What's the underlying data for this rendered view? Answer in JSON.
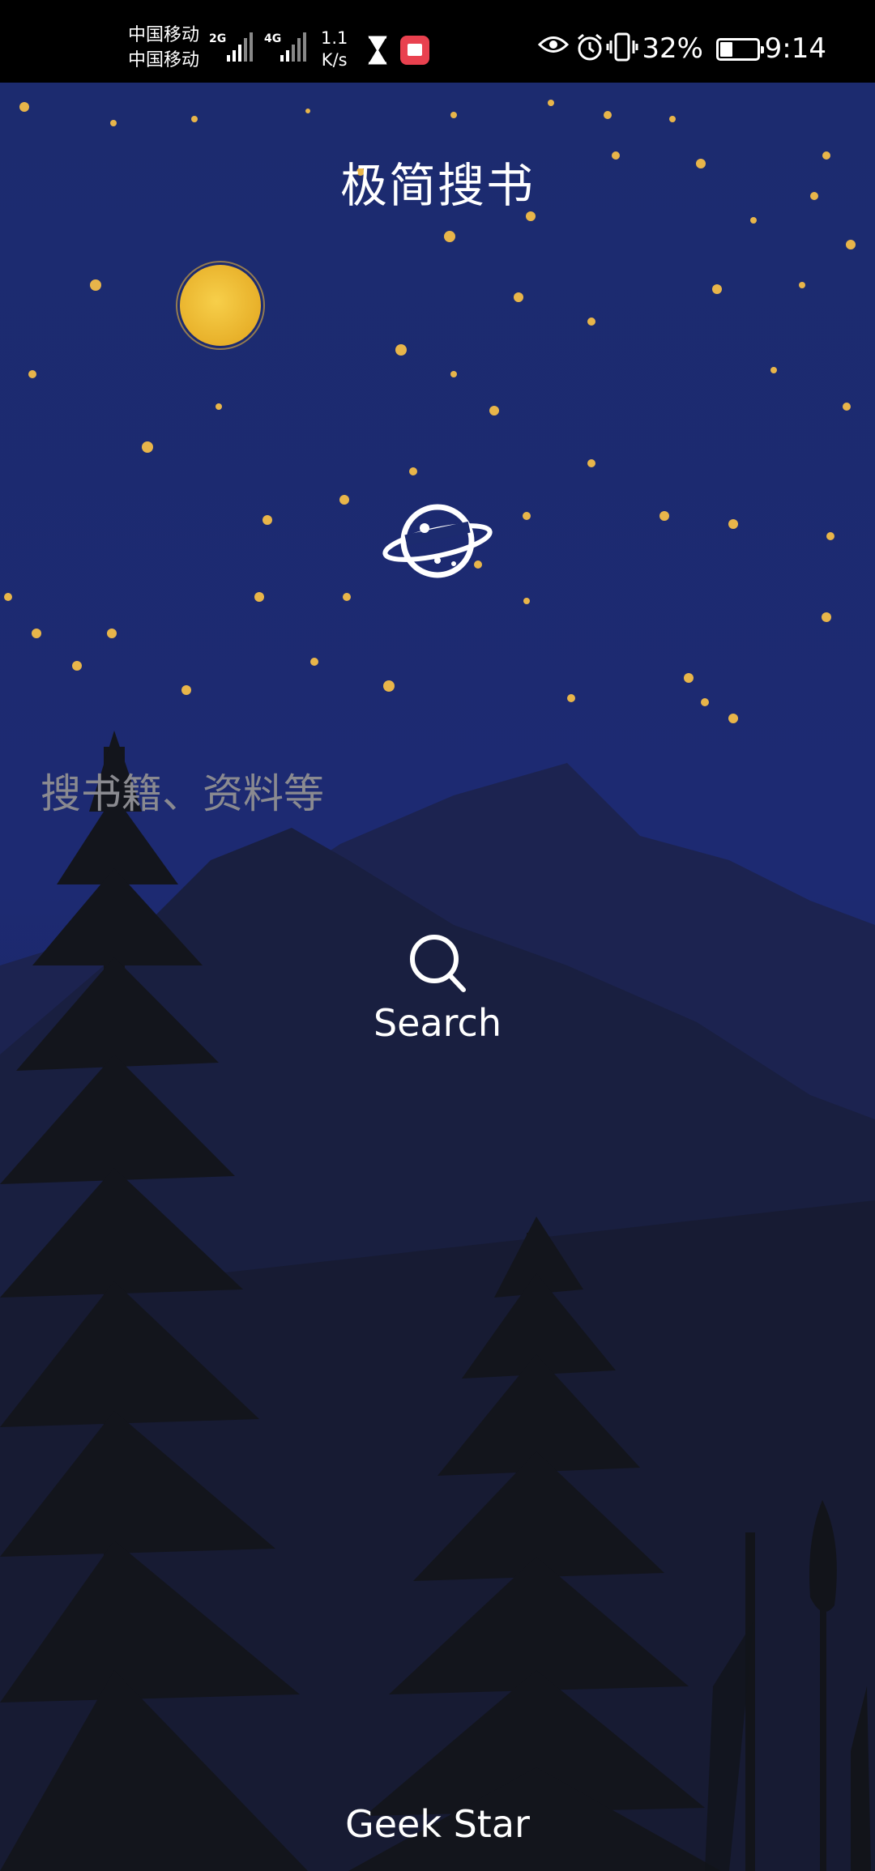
{
  "status_bar": {
    "carrier_1": "中国移动",
    "carrier_2": "中国移动",
    "net_1": "2G",
    "net_2": "4G",
    "speed_value": "1.1",
    "speed_unit": "K/s",
    "battery_percent": "32%",
    "time": "9:14"
  },
  "app": {
    "title": "极简搜书"
  },
  "search": {
    "placeholder": "搜书籍、资料等",
    "button_label": "Search"
  },
  "footer": {
    "text": "Geek Star"
  },
  "colors": {
    "sky": "#1b2a6e",
    "moon": "#f3c33a",
    "star": "#e9b64a",
    "trees": "#14161d",
    "mountain": "#1e2449"
  }
}
